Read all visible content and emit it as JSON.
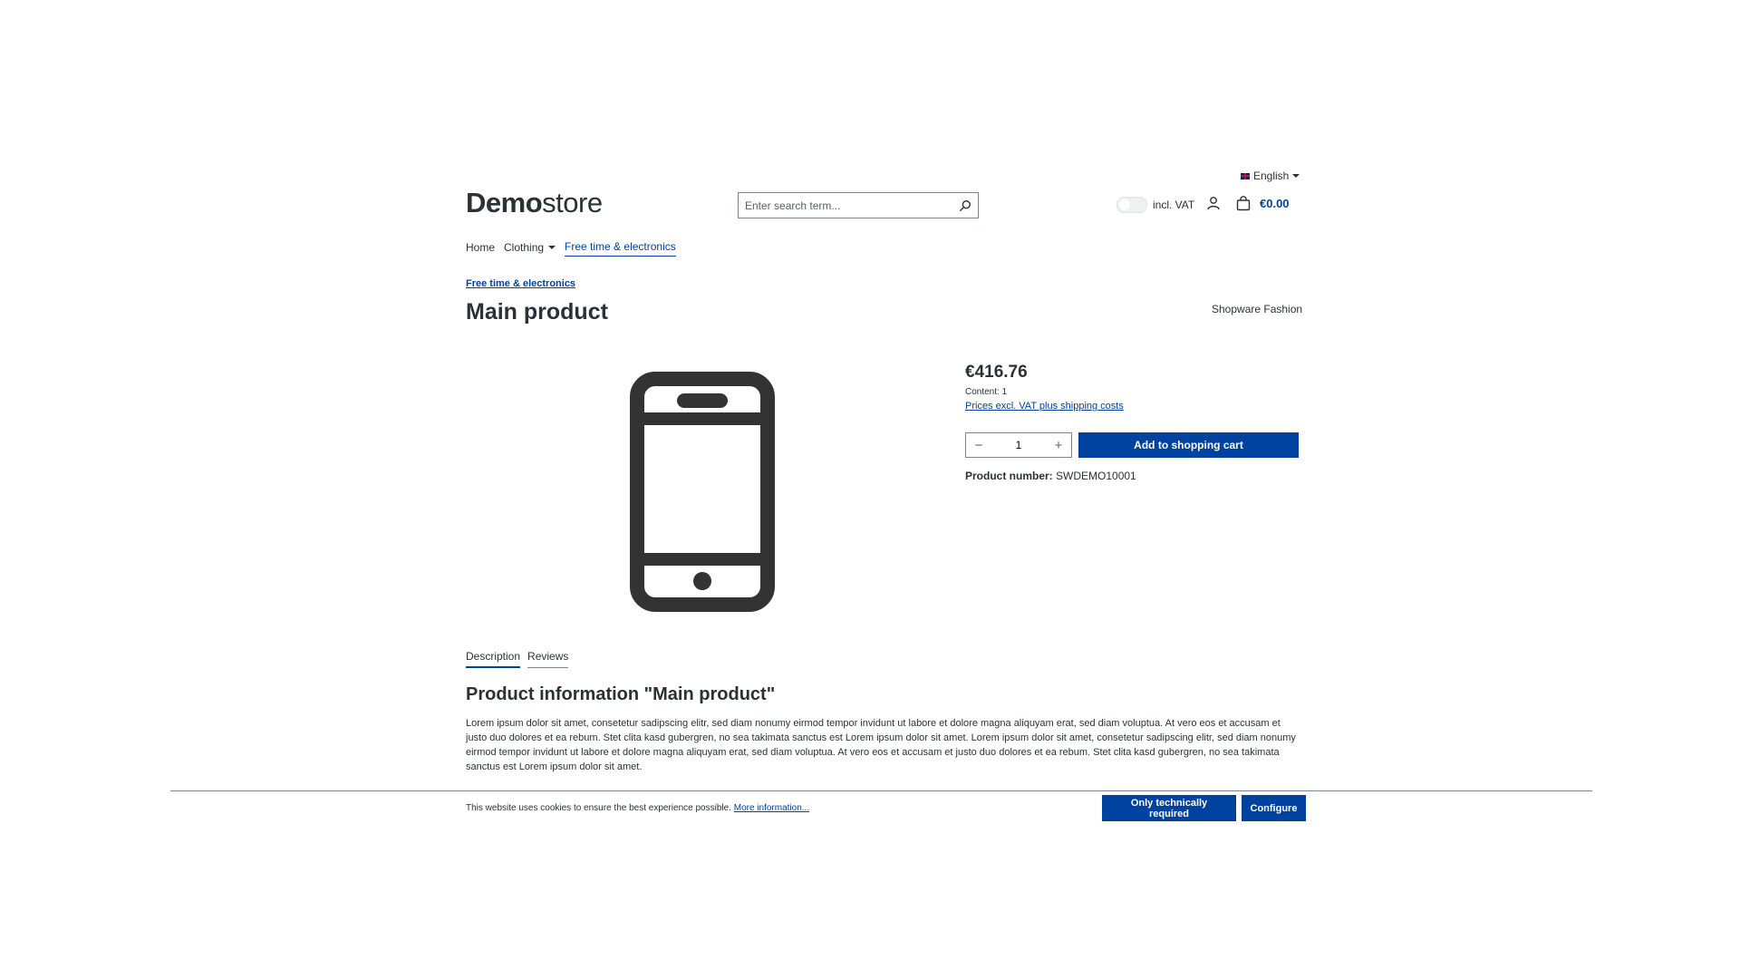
{
  "header": {
    "language": "English",
    "logo_bold": "Demo",
    "logo_regular": "store",
    "search_placeholder": "Enter search term...",
    "vat_label": "incl. VAT",
    "cart_total": "€0.00"
  },
  "nav": {
    "items": [
      "Home",
      "Clothing",
      "Free time & electronics"
    ]
  },
  "product": {
    "breadcrumb": "Free time & electronics",
    "title": "Main product",
    "manufacturer": "Shopware Fashion",
    "price": "€416.76",
    "content": "Content: 1",
    "tax_note": "Prices excl. VAT plus shipping costs",
    "quantity": "1",
    "add_to_cart": "Add to shopping cart",
    "number_label": "Product number:",
    "number_value": "SWDEMO10001"
  },
  "tabs": [
    "Description",
    "Reviews"
  ],
  "description": {
    "title": "Product information \"Main product\"",
    "text": "Lorem ipsum dolor sit amet, consetetur sadipscing elitr, sed diam nonumy eirmod tempor invidunt ut labore et dolore magna aliquyam erat, sed diam voluptua. At vero eos et accusam et justo duo dolores et ea rebum. Stet clita kasd gubergren, no sea takimata sanctus est Lorem ipsum dolor sit amet. Lorem ipsum dolor sit amet, consetetur sadipscing elitr, sed diam nonumy eirmod tempor invidunt ut labore et dolore magna aliquyam erat, sed diam voluptua. At vero eos et accusam et justo duo dolores et ea rebum. Stet clita kasd gubergren, no sea takimata sanctus est Lorem ipsum dolor sit amet."
  },
  "cookie": {
    "text": "This website uses cookies to ensure the best experience possible.",
    "more_info": "More information...",
    "button_required": "Only technically required",
    "button_configure": "Configure"
  },
  "icons": {
    "flag": "uk-flag-icon",
    "search": "search-icon",
    "account": "user-icon",
    "cart": "shopping-bag-icon",
    "product_image": "smartphone-icon"
  },
  "colors": {
    "primary": "#0042a0",
    "text": "#2b3136"
  }
}
